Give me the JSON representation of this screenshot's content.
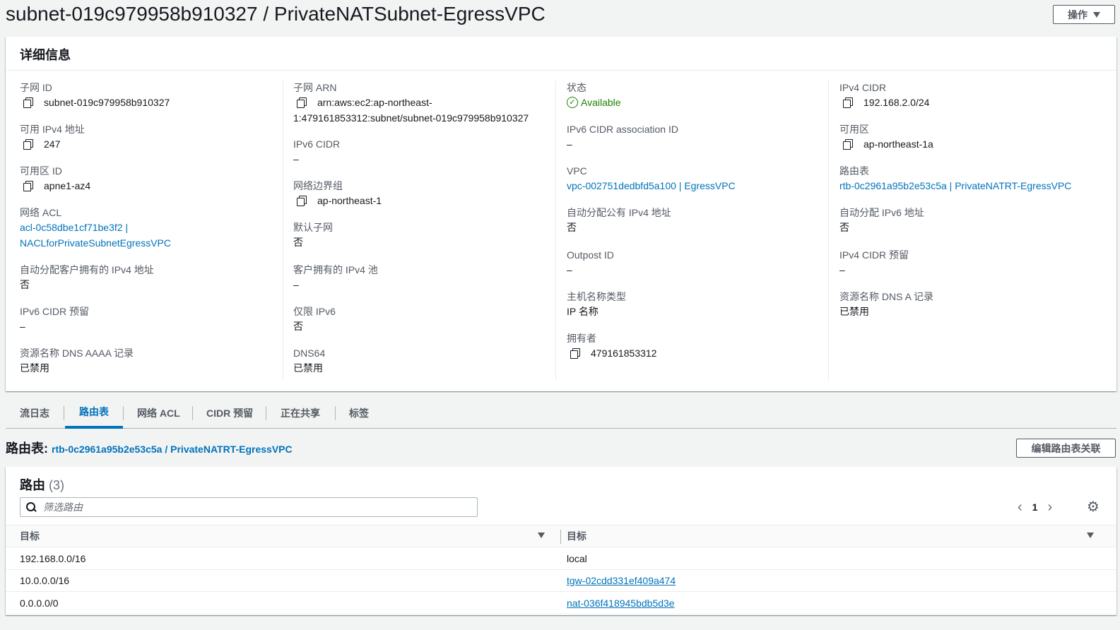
{
  "page": {
    "title": "subnet-019c979958b910327 / PrivateNATSubnet-EgressVPC",
    "actions_label": "操作"
  },
  "details": {
    "header": "详细信息",
    "col1": [
      {
        "label": "子网 ID",
        "value": "subnet-019c979958b910327"
      },
      {
        "label": "可用 IPv4 地址",
        "value": "247"
      },
      {
        "label": "可用区 ID",
        "value": "apne1-az4"
      },
      {
        "label": "网络 ACL",
        "value_line1": "acl-0c58dbe1cf71be3f2 |",
        "value_line2": "NACLforPrivateSubnetEgressVPC"
      },
      {
        "label": "自动分配客户拥有的 IPv4 地址",
        "value": "否"
      },
      {
        "label": "IPv6 CIDR 预留",
        "value": "–"
      },
      {
        "label": "资源名称 DNS AAAA 记录",
        "value": "已禁用"
      }
    ],
    "col2": [
      {
        "label": "子网 ARN",
        "value_line1": "arn:aws:ec2:ap-northeast-",
        "value_line2": "1:479161853312:subnet/subnet-019c979958b910327"
      },
      {
        "label": "IPv6 CIDR",
        "value": "–"
      },
      {
        "label": "网络边界组",
        "value": "ap-northeast-1"
      },
      {
        "label": "默认子网",
        "value": "否"
      },
      {
        "label": "客户拥有的 IPv4 池",
        "value": "–"
      },
      {
        "label": "仅限 IPv6",
        "value": "否"
      },
      {
        "label": "DNS64",
        "value": "已禁用"
      }
    ],
    "col3": [
      {
        "label": "状态",
        "value": "Available"
      },
      {
        "label": "IPv6 CIDR association ID",
        "value": "–"
      },
      {
        "label": "VPC",
        "value": "vpc-002751dedbfd5a100 | EgressVPC"
      },
      {
        "label": "自动分配公有 IPv4 地址",
        "value": "否"
      },
      {
        "label": "Outpost ID",
        "value": "–"
      },
      {
        "label": "主机名称类型",
        "value": "IP 名称"
      },
      {
        "label": "拥有者",
        "value": "479161853312"
      }
    ],
    "col4": [
      {
        "label": "IPv4 CIDR",
        "value": "192.168.2.0/24"
      },
      {
        "label": "可用区",
        "value": "ap-northeast-1a"
      },
      {
        "label": "路由表",
        "value": "rtb-0c2961a95b2e53c5a | PrivateNATRT-EgressVPC"
      },
      {
        "label": "自动分配 IPv6 地址",
        "value": "否"
      },
      {
        "label": "IPv4 CIDR 预留",
        "value": "–"
      },
      {
        "label": "资源名称 DNS A 记录",
        "value": "已禁用"
      }
    ]
  },
  "tabs": [
    "流日志",
    "路由表",
    "网络 ACL",
    "CIDR 预留",
    "正在共享",
    "标签"
  ],
  "route_table": {
    "label": "路由表:",
    "link": "rtb-0c2961a95b2e53c5a / PrivateNATRT-EgressVPC",
    "edit_button": "编辑路由表关联"
  },
  "routes": {
    "header": "路由",
    "count": "(3)",
    "filter_placeholder": "筛选路由",
    "page": "1",
    "columns": [
      "目标",
      "目标"
    ],
    "rows": [
      {
        "destination": "192.168.0.0/16",
        "target": "local",
        "target_link": false
      },
      {
        "destination": "10.0.0.0/16",
        "target": "tgw-02cdd331ef409a474",
        "target_link": true
      },
      {
        "destination": "0.0.0.0/0",
        "target": "nat-036f418945bdb5d3e",
        "target_link": true
      }
    ]
  },
  "colors": {
    "link": "#0073bb",
    "status_ok": "#1d8102",
    "background": "#f2f3f3"
  }
}
